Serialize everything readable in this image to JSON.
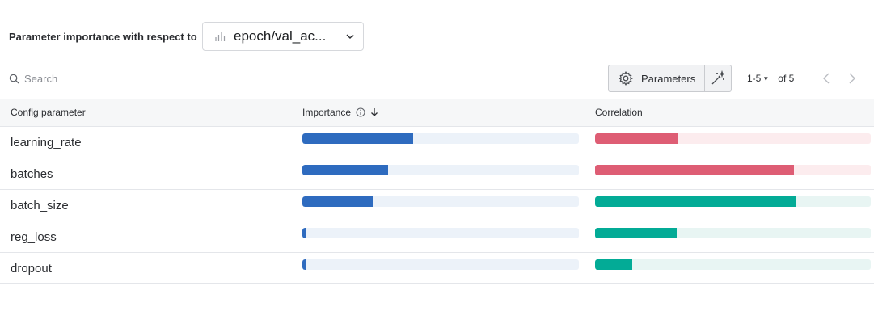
{
  "header": {
    "label": "Parameter importance with respect to",
    "metric_value": "epoch/val_ac...",
    "metric_icon": "bar-chart-icon"
  },
  "toolbar": {
    "search_placeholder": "Search",
    "parameters_label": "Parameters",
    "page_range": "1-5",
    "page_of": "of 5"
  },
  "table": {
    "columns": [
      "Config parameter",
      "Importance",
      "Correlation"
    ],
    "rows": [
      {
        "name": "learning_rate",
        "importance": 0.4,
        "correlation": -0.3
      },
      {
        "name": "batches",
        "importance": 0.31,
        "correlation": -0.72
      },
      {
        "name": "batch_size",
        "importance": 0.255,
        "correlation": 0.73
      },
      {
        "name": "reg_loss",
        "importance": 0.015,
        "correlation": 0.295
      },
      {
        "name": "dropout",
        "importance": 0.015,
        "correlation": 0.135
      }
    ]
  },
  "colors": {
    "importance_bar": "#2e6bbf",
    "negative_correlation": "#de5d74",
    "positive_correlation": "#03ab96"
  }
}
